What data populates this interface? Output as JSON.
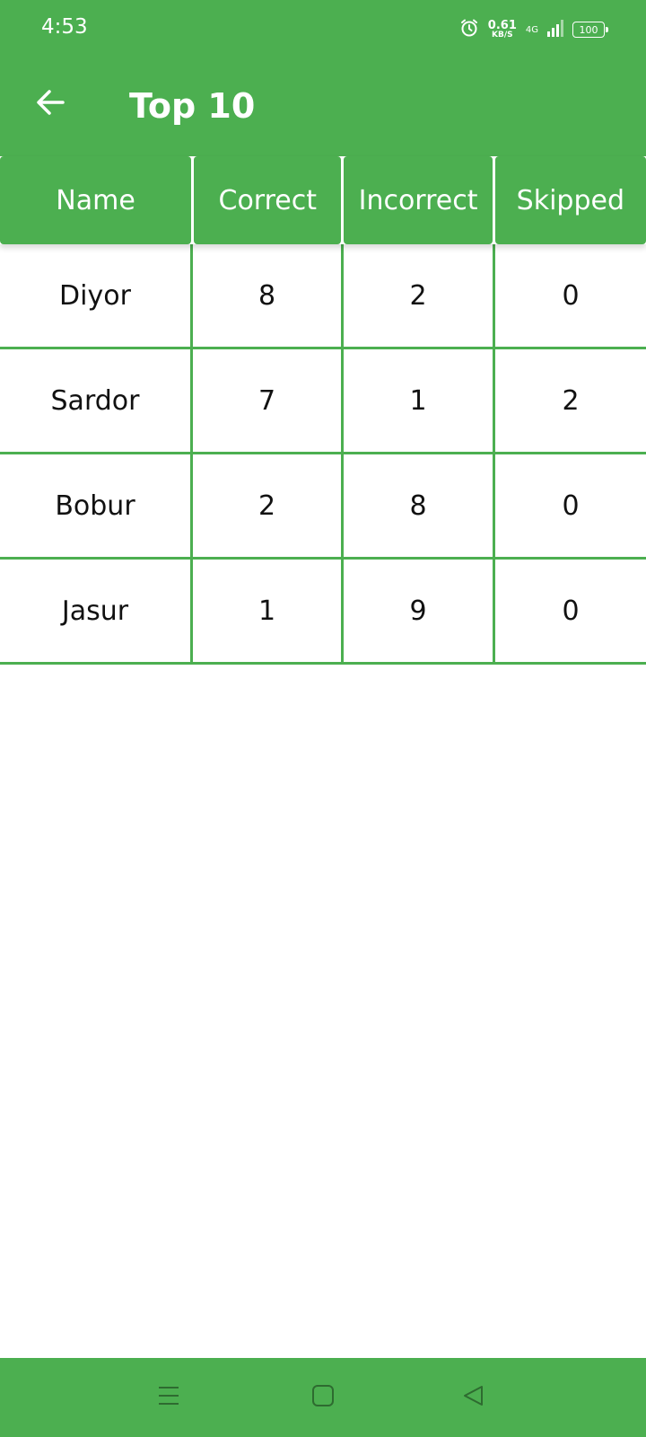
{
  "status_bar": {
    "time": "4:53",
    "net_speed_value": "0.61",
    "net_speed_unit": "KB/S",
    "network": "4G",
    "battery": "100"
  },
  "app_bar": {
    "title": "Top 10"
  },
  "table": {
    "headers": [
      "Name",
      "Correct",
      "Incorrect",
      "Skipped"
    ],
    "rows": [
      [
        "Diyor",
        "8",
        "2",
        "0"
      ],
      [
        "Sardor",
        "7",
        "1",
        "2"
      ],
      [
        "Bobur",
        "2",
        "8",
        "0"
      ],
      [
        "Jasur",
        "1",
        "9",
        "0"
      ]
    ]
  },
  "colors": {
    "primary": "#4caf50",
    "text": "#111111",
    "background": "#ffffff"
  },
  "icons": {
    "back": "arrow-left-icon",
    "nav_menu": "menu-icon",
    "nav_home": "home-icon",
    "nav_back": "back-triangle-icon"
  }
}
